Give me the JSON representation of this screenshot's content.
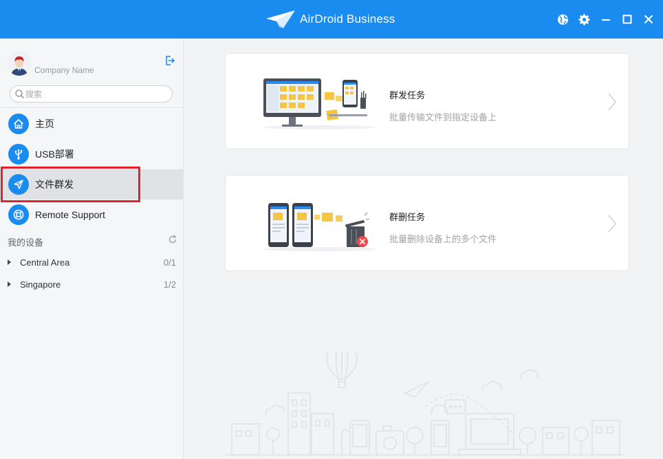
{
  "titlebar": {
    "app_name": "AirDroid Business"
  },
  "sidebar": {
    "company_name": "Company Name",
    "search_placeholder": "搜索",
    "nav": [
      {
        "label": "主页",
        "icon": "home-icon"
      },
      {
        "label": "USB部署",
        "icon": "usb-icon"
      },
      {
        "label": "文件群发",
        "icon": "send-icon",
        "active": true
      },
      {
        "label": "Remote Support",
        "icon": "lifebuoy-icon"
      }
    ],
    "devices_title": "我的设备",
    "groups": [
      {
        "name": "Central Area",
        "count": "0/1"
      },
      {
        "name": "Singapore",
        "count": "1/2"
      }
    ]
  },
  "main": {
    "cards": [
      {
        "title": "群发任务",
        "desc": "批量传输文件到指定设备上"
      },
      {
        "title": "群删任务",
        "desc": "批量删除设备上的多个文件"
      }
    ]
  },
  "colors": {
    "brand": "#1a8cf0",
    "highlight": "#e0222b",
    "folder": "#f5c643"
  }
}
